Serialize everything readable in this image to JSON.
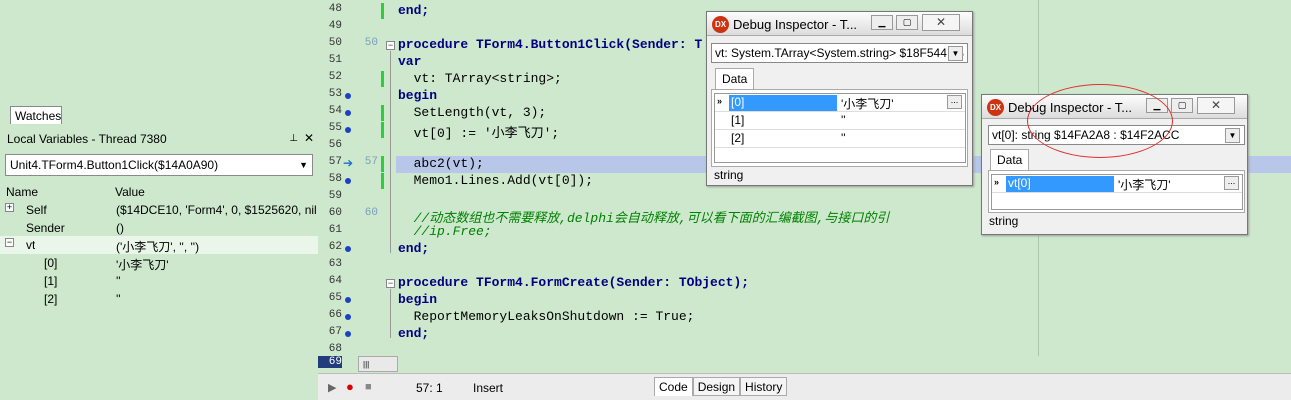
{
  "left_panel": {
    "tab": "Watches",
    "title": "Local Variables - Thread 7380",
    "pin": "📌",
    "close": "✖",
    "combo_value": "Unit4.TForm4.Button1Click($14A0A90)",
    "columns": {
      "name": "Name",
      "value": "Value"
    },
    "rows": [
      {
        "name": "Self",
        "value": "($14DCE10, 'Form4', 0, $1525620, nil,"
      },
      {
        "name": "Sender",
        "value": "()"
      },
      {
        "name": "vt",
        "value": "('小李飞刀', '', '')"
      },
      {
        "name": "[0]",
        "value": "'小李飞刀'"
      },
      {
        "name": "[1]",
        "value": "''"
      },
      {
        "name": "[2]",
        "value": "''"
      }
    ]
  },
  "editor": {
    "lines": [
      {
        "n": "48",
        "n2": "",
        "code": "end;"
      },
      {
        "n": "49",
        "n2": "",
        "code": ""
      },
      {
        "n": "50",
        "n2": "50",
        "code": "procedure TForm4.Button1Click(Sender: T"
      },
      {
        "n": "51",
        "n2": "",
        "code": "var"
      },
      {
        "n": "52",
        "n2": "",
        "code": "  vt: TArray<string>;"
      },
      {
        "n": "53",
        "n2": "",
        "code": "begin"
      },
      {
        "n": "54",
        "n2": "",
        "code": "  SetLength(vt, 3);"
      },
      {
        "n": "55",
        "n2": "",
        "code": "  vt[0] := '小李飞刀';"
      },
      {
        "n": "56",
        "n2": "",
        "code": ""
      },
      {
        "n": "57",
        "n2": "57",
        "code": "  abc2(vt);"
      },
      {
        "n": "58",
        "n2": "",
        "code": "  Memo1.Lines.Add(vt[0]);"
      },
      {
        "n": "59",
        "n2": "",
        "code": ""
      },
      {
        "n": "60",
        "n2": "60",
        "code": "  //动态数组也不需要释放,delphi会自动释放,可以看下面的汇编截图,与接口的引"
      },
      {
        "n": "61",
        "n2": "",
        "code": "  //ip.Free;"
      },
      {
        "n": "62",
        "n2": "",
        "code": "end;"
      },
      {
        "n": "63",
        "n2": "",
        "code": ""
      },
      {
        "n": "64",
        "n2": "",
        "code": "procedure TForm4.FormCreate(Sender: TObject);"
      },
      {
        "n": "65",
        "n2": "",
        "code": "begin"
      },
      {
        "n": "66",
        "n2": "",
        "code": "  ReportMemoryLeaksOnShutdown := True;"
      },
      {
        "n": "67",
        "n2": "",
        "code": "end;"
      },
      {
        "n": "68",
        "n2": "",
        "code": ""
      }
    ],
    "current_line": "69"
  },
  "status": {
    "position": "57:  1",
    "mode": "Insert",
    "tabs": [
      "Code",
      "Design",
      "History"
    ]
  },
  "inspector1": {
    "title": "Debug Inspector - T...",
    "logo": "DX",
    "combo": "vt: System.TArray<System.string> $18F544 : $",
    "tab": "Data",
    "rows": [
      {
        "k": "[0]",
        "v": "'小李飞刀'"
      },
      {
        "k": "[1]",
        "v": "''"
      },
      {
        "k": "[2]",
        "v": "''"
      }
    ],
    "status": "string"
  },
  "inspector2": {
    "title": "Debug Inspector - T...",
    "logo": "DX",
    "combo": "vt[0]: string $14FA2A8 : $14F2ACC",
    "tab": "Data",
    "rows": [
      {
        "k": "vt[0]",
        "v": "'小李飞刀'"
      }
    ],
    "status": "string"
  },
  "colors": {
    "background": "#cde8cd",
    "selection": "#3399ff",
    "exec_line": "#b7c6e9",
    "annotation": "#e03030"
  }
}
